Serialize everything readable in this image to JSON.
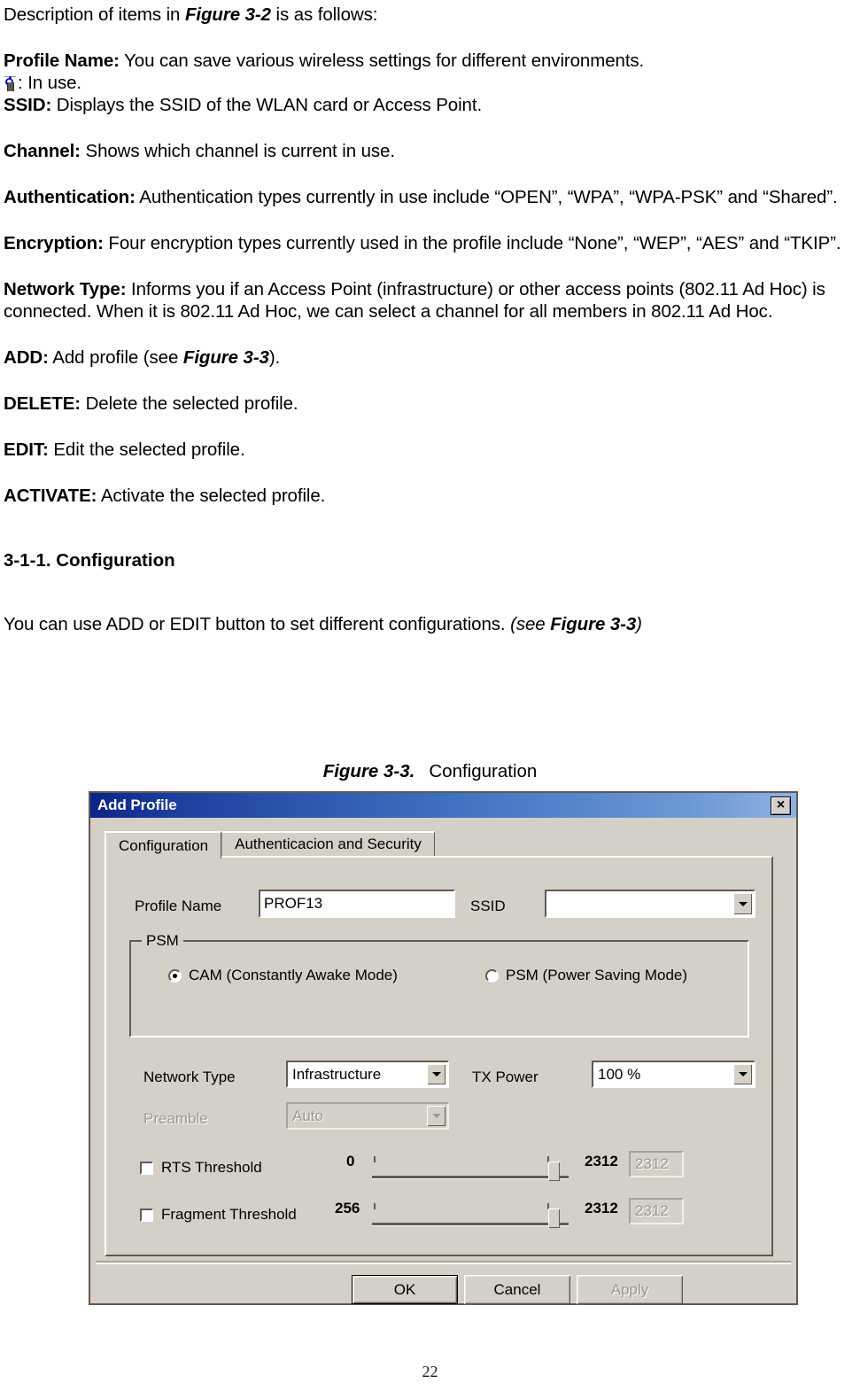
{
  "document": {
    "intro": {
      "pre": "Description of items in ",
      "figure_ref": "Figure 3-2",
      "post": " is as follows:"
    },
    "entries": [
      {
        "term": "Profile Name:",
        "text": " You can save various wireless settings for different environments."
      },
      {
        "term": "",
        "icon": "in-use-antenna-icon",
        "text": ": In use."
      },
      {
        "term": "SSID:",
        "text": " Displays the SSID of the WLAN card or Access Point."
      },
      {
        "term": "Channel:",
        "text": " Shows which channel is current in use."
      },
      {
        "term": "Authentication:",
        "text": " Authentication types currently in use include “OPEN”, “WPA”, “WPA-PSK” and “Shared”."
      },
      {
        "term": "Encryption:",
        "text": " Four encryption types currently used in the profile include “None”, “WEP”, “AES” and “TKIP”."
      },
      {
        "term": "Network Type:",
        "text": " Informs you if an Access Point (infrastructure) or other access points (802.11 Ad Hoc) is connected. When it is 802.11 Ad Hoc, we can select a channel for all members in 802.11 Ad Hoc."
      },
      {
        "term": "ADD:",
        "text": " Add profile (see ",
        "figure_ref": "Figure 3-3",
        "text_after": ")."
      },
      {
        "term": "DELETE:",
        "text": " Delete the selected profile."
      },
      {
        "term": "EDIT:",
        "text": " Edit the selected profile."
      },
      {
        "term": "ACTIVATE:",
        "text": " Activate the selected profile."
      }
    ],
    "section_heading": "3-1-1. Configuration",
    "section_body": {
      "pre": "You can use ADD or EDIT button to set different configurations. ",
      "paren_open": "(see ",
      "figure_ref": "Figure 3-3",
      "paren_close": ")"
    },
    "figure_caption": {
      "label": "Figure 3-3.",
      "name": "Configuration"
    },
    "page_number": "22"
  },
  "dialog": {
    "title": "Add Profile",
    "close_label": "×",
    "tabs": [
      {
        "label": "Configuration",
        "active": true
      },
      {
        "label": "Authenticacion and Security",
        "active": false
      }
    ],
    "fields": {
      "profile_name_label": "Profile Name",
      "profile_name_value": "PROF13",
      "ssid_label": "SSID",
      "ssid_value": "",
      "network_type_label": "Network Type",
      "network_type_value": "Infrastructure",
      "tx_power_label": "TX Power",
      "tx_power_value": "100 %",
      "preamble_label": "Preamble",
      "preamble_value": "Auto"
    },
    "psm": {
      "group_label": "PSM",
      "options": [
        {
          "label": "CAM (Constantly Awake Mode)",
          "selected": true
        },
        {
          "label": "PSM (Power Saving Mode)",
          "selected": false
        }
      ]
    },
    "thresholds": [
      {
        "label": "RTS Threshold",
        "checked": false,
        "min": "0",
        "max": "2312",
        "value": "2312"
      },
      {
        "label": "Fragment Threshold",
        "checked": false,
        "min": "256",
        "max": "2312",
        "value": "2312"
      }
    ],
    "buttons": [
      {
        "label": "OK",
        "state": "default"
      },
      {
        "label": "Cancel",
        "state": "normal"
      },
      {
        "label": "Apply",
        "state": "disabled"
      }
    ],
    "colors": {
      "face": "#d4d0c8",
      "title_start": "#0a2488",
      "title_end": "#8fb3e2",
      "shadow": "#5e5a54",
      "disabled_text": "#9b9792"
    }
  }
}
